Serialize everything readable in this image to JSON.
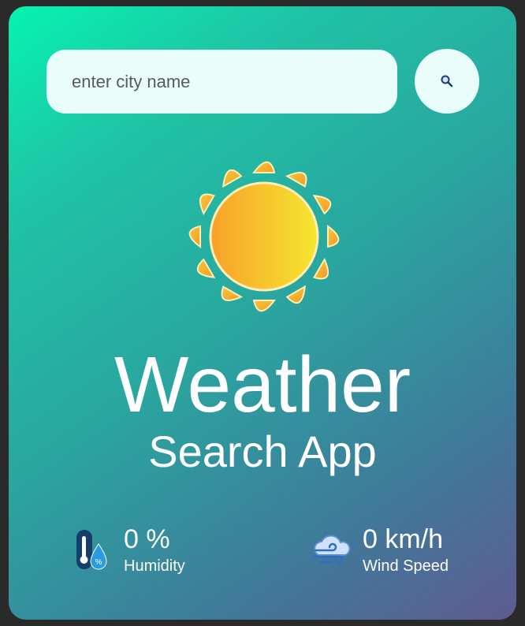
{
  "search": {
    "placeholder": "enter city name",
    "value": "",
    "button_icon": "search-icon"
  },
  "weather_icon": "sun-icon",
  "title": {
    "main": "Weather",
    "sub": "Search App"
  },
  "stats": {
    "humidity": {
      "icon": "humidity-icon",
      "value": "0 %",
      "label": "Humidity"
    },
    "wind": {
      "icon": "wind-icon",
      "value": "0 km/h",
      "label": "Wind Speed"
    }
  },
  "colors": {
    "gradient_start": "#06f3b1",
    "gradient_end": "#5f5b92",
    "input_bg": "#e9fdfb",
    "text": "#ffffff"
  }
}
